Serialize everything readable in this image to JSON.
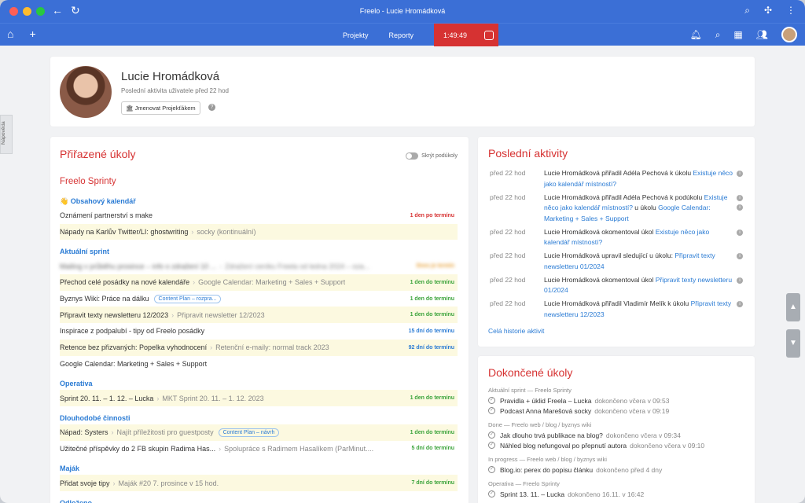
{
  "window": {
    "title": "Freelo - Lucie Hromádková"
  },
  "navbar": {
    "projects": "Projekty",
    "reports": "Reporty",
    "timer": "1:49:49"
  },
  "sidebar_help": "Nápověda",
  "profile": {
    "name": "Lucie Hromádková",
    "last_activity": "Poslední aktivita uživatele před 22 hod",
    "button": "Jmenovat Projekťákem",
    "help": "?"
  },
  "tasks": {
    "title": "Přiřazené úkoly",
    "toggle_label": "Skrýt podúkoly",
    "project": "Freelo Sprinty",
    "sections": [
      {
        "name": "👋 Obsahový kalendář",
        "rows": [
          {
            "name": "Oznámení partnerství s make",
            "sub": "",
            "tag": "",
            "due": "1 den po termínu",
            "due_color": "red",
            "hl": false,
            "blur": false
          },
          {
            "name": "Nápady na Karlův Twitter/LI: ghostwriting",
            "sub": "socky (kontinuální)",
            "tag": "",
            "due": "",
            "due_color": "",
            "hl": true,
            "blur": false
          }
        ]
      },
      {
        "name": "Aktuální sprint",
        "rows": [
          {
            "name": "Mailing v průběhu prosince – info o zdražení 10 ...",
            "sub": "Zdražení ceníku Freela od ledna 2024 – oza...",
            "tag": "",
            "due": "Dnes je termín",
            "due_color": "orange",
            "hl": false,
            "blur": true
          },
          {
            "name": "Přechod celé posádky na nové kalendáře",
            "sub": "Google Calendar: Marketing + Sales + Support",
            "tag": "",
            "due": "1 den do termínu",
            "due_color": "green",
            "hl": true,
            "blur": false
          },
          {
            "name": "Byznys Wiki: Práce na dálku",
            "sub": "",
            "tag": "Content Plan – rozpra...",
            "due": "1 den do termínu",
            "due_color": "green",
            "hl": false,
            "blur": false
          },
          {
            "name": "Připravit texty newsletteru 12/2023",
            "sub": "Připravit newsletter 12/2023",
            "tag": "",
            "due": "1 den do termínu",
            "due_color": "green",
            "hl": true,
            "blur": false
          },
          {
            "name": "Inspirace z podpalubí - tipy od Freelo posádky",
            "sub": "",
            "tag": "",
            "due": "15 dní do termínu",
            "due_color": "blue",
            "hl": false,
            "blur": false
          },
          {
            "name": "Retence bez přizvaných: Popelka vyhodnocení",
            "sub": "Retenční e-maily: normal track 2023",
            "tag": "",
            "due": "92 dní do termínu",
            "due_color": "blue",
            "hl": true,
            "blur": false
          },
          {
            "name": "Google Calendar: Marketing + Sales + Support",
            "sub": "",
            "tag": "",
            "due": "",
            "due_color": "",
            "hl": false,
            "blur": false
          }
        ]
      },
      {
        "name": "Operativa",
        "rows": [
          {
            "name": "Sprint 20. 11. – 1. 12. – Lucka",
            "sub": "MKT Sprint 20. 11. – 1. 12. 2023",
            "tag": "",
            "due": "1 den do termínu",
            "due_color": "green",
            "hl": true,
            "blur": false
          }
        ]
      },
      {
        "name": "Dlouhodobé činnosti",
        "rows": [
          {
            "name": "Nápad: Systers",
            "sub": "Najít příležitosti pro guestposty",
            "tag": "Content Plan – návrh",
            "due": "1 den do termínu",
            "due_color": "green",
            "hl": true,
            "blur": false
          },
          {
            "name": "Užitečné příspěvky do 2 FB skupin Radima Has...",
            "sub": "Spolupráce s Radimem Hasalíkem (ParMinut....",
            "tag": "",
            "due": "5 dní do termínu",
            "due_color": "green",
            "hl": false,
            "blur": false
          }
        ]
      },
      {
        "name": "Maják",
        "rows": [
          {
            "name": "Přidat svoje tipy",
            "sub": "Maják #20 7. prosince v 15 hod.",
            "tag": "",
            "due": "7 dní do termínu",
            "due_color": "green",
            "hl": true,
            "blur": false
          }
        ]
      },
      {
        "name": "Odloženo",
        "rows": []
      }
    ]
  },
  "activity": {
    "title": "Poslední aktivity",
    "items": [
      {
        "time": "před 22 hod",
        "text": "Lucie Hromádková přiřadil Adéla Pechová k úkolu ",
        "link": "Existuje něco jako kalendář místností?",
        "after": "",
        "link2": "",
        "icons": 1
      },
      {
        "time": "před 22 hod",
        "text": "Lucie Hromádková přiřadil Adéla Pechová k podúkolu ",
        "link": "Existuje něco jako kalendář místností?",
        "after": " u úkolu ",
        "link2": "Google Calendar: Marketing + Sales + Support",
        "icons": 2
      },
      {
        "time": "před 22 hod",
        "text": "Lucie Hromádková okomentoval úkol ",
        "link": "Existuje něco jako kalendář místností?",
        "after": "",
        "link2": "",
        "icons": 1
      },
      {
        "time": "před 22 hod",
        "text": "Lucie Hromádková upravil sledující u úkolu: ",
        "link": "Připravit texty newsletteru 01/2024",
        "after": "",
        "link2": "",
        "icons": 1
      },
      {
        "time": "před 22 hod",
        "text": "Lucie Hromádková okomentoval úkol ",
        "link": "Připravit texty newsletteru 01/2024",
        "after": "",
        "link2": "",
        "icons": 1
      },
      {
        "time": "před 22 hod",
        "text": "Lucie Hromádková přiřadil Vladimír Melík k úkolu ",
        "link": "Připravit texty newsletteru 12/2023",
        "after": "",
        "link2": "",
        "icons": 1
      }
    ],
    "history_link": "Celá historie aktivit"
  },
  "done": {
    "title": "Dokončené úkoly",
    "groups": [
      {
        "label": "Aktuální sprint — Freelo Sprinty",
        "items": [
          {
            "name": "Pravidla + úklid Freela – Lucka",
            "meta": "dokončeno včera v 09:53"
          },
          {
            "name": "Podcast Anna Marešová socky",
            "meta": "dokončeno včera v 09:19"
          }
        ]
      },
      {
        "label": "Done — Freelo web / blog / byznys wiki",
        "items": [
          {
            "name": "Jak dlouho trvá publikace na blog?",
            "meta": "dokončeno včera v 09:34"
          },
          {
            "name": "Náhled blog nefungoval po přepnutí autora",
            "meta": "dokončeno včera v 09:10"
          }
        ]
      },
      {
        "label": "In progress — Freelo web / blog / byznys wiki",
        "items": [
          {
            "name": "Blog.io: perex do popisu článku",
            "meta": "dokončeno před 4 dny"
          }
        ]
      },
      {
        "label": "Operativa — Freelo Sprinty",
        "items": [
          {
            "name": "Sprint 13. 11. – Lucka",
            "meta": "dokončeno 16.11. v 16:42"
          }
        ]
      }
    ]
  }
}
